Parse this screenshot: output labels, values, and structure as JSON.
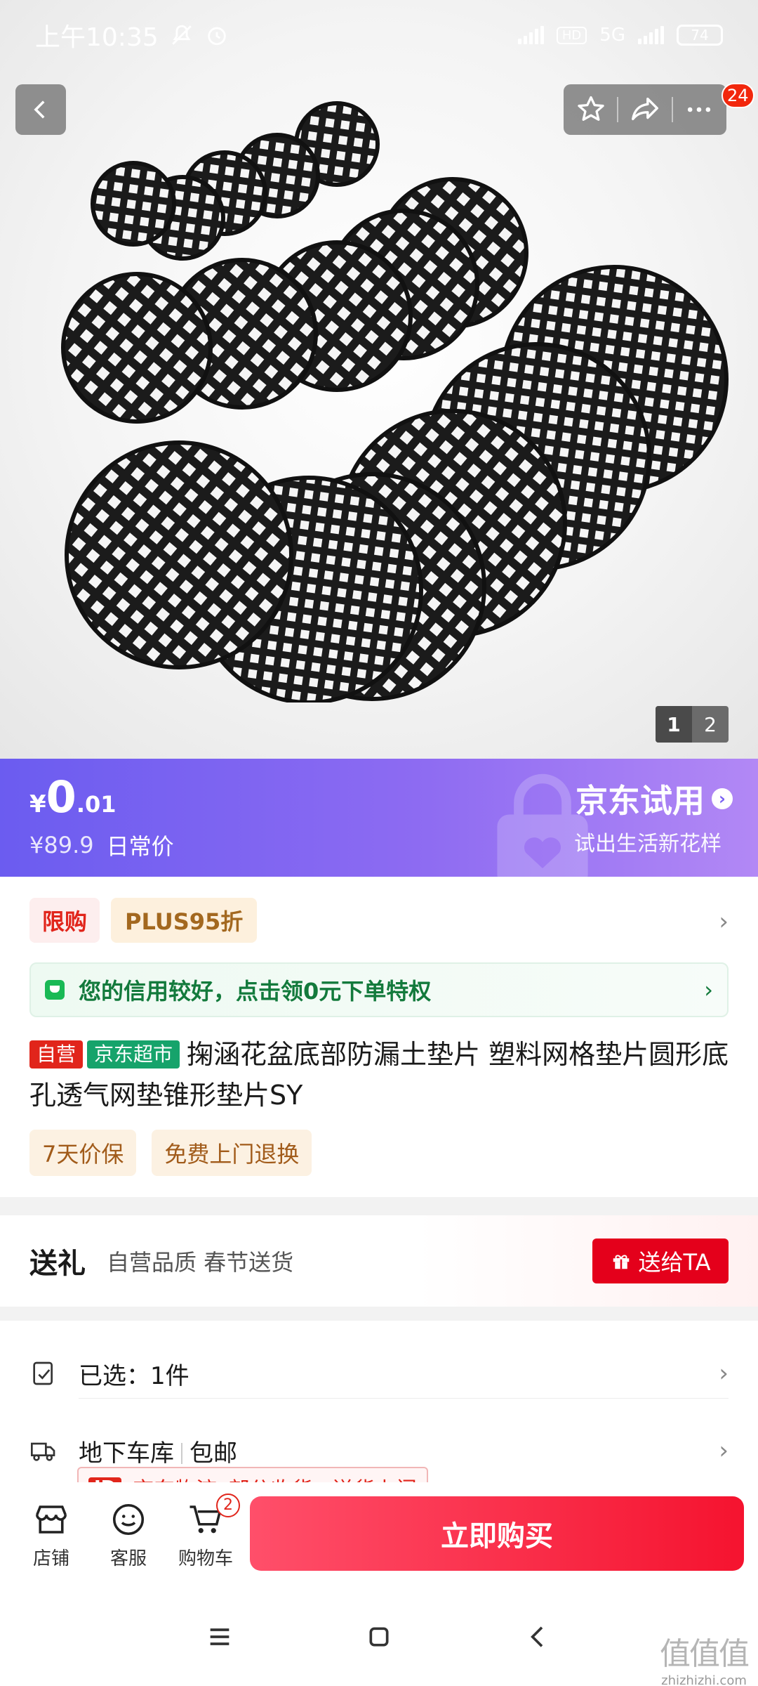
{
  "status_bar": {
    "time": "上午10:35",
    "network": "5G",
    "hd": "HD",
    "battery": "74"
  },
  "top_bar": {
    "notification_count": "24",
    "icons": [
      "back-icon",
      "star-icon",
      "share-icon",
      "more-icon"
    ]
  },
  "gallery": {
    "pages": [
      "1",
      "2"
    ],
    "current_page": "1"
  },
  "price": {
    "yen_symbol": "¥",
    "integer": "0",
    "decimal": ".01",
    "original_price": "¥89.9",
    "original_label": "日常价",
    "trial_title": "京东试用",
    "trial_subtitle": "试出生活新花样"
  },
  "promo": {
    "limit_tag": "限购",
    "plus_tag": "PLUS95折"
  },
  "credit": {
    "text": "您的信用较好，点击领0元下单特权"
  },
  "product": {
    "self_operated": "自营",
    "market_tag": "京东超市",
    "title": "掬涵花盆底部防漏土垫片 塑料网格垫片圆形底孔透气网垫锥形垫片SY"
  },
  "services": [
    "7天价保",
    "免费上门退换"
  ],
  "gift": {
    "label": "送礼",
    "desc": "自营品质 春节送货",
    "button": "送给TA"
  },
  "selection": {
    "selected": "已选：1件",
    "address": "地下车库",
    "shipping": "包邮",
    "logistics_brand": "JD",
    "logistics_name": "京东物流",
    "logistics_desc": "部分收货 · 送货上门"
  },
  "bottom_nav": {
    "store": "店铺",
    "service": "客服",
    "cart": "购物车",
    "cart_count": "2",
    "buy_now": "立即购买"
  },
  "watermark": {
    "logo": "值值值",
    "domain": "zhizhizhi.com"
  },
  "colors": {
    "accent_red": "#e1251b",
    "price_band_start": "#6b5cf0",
    "price_band_end": "#b288f5",
    "credit_green": "#137a3c"
  }
}
